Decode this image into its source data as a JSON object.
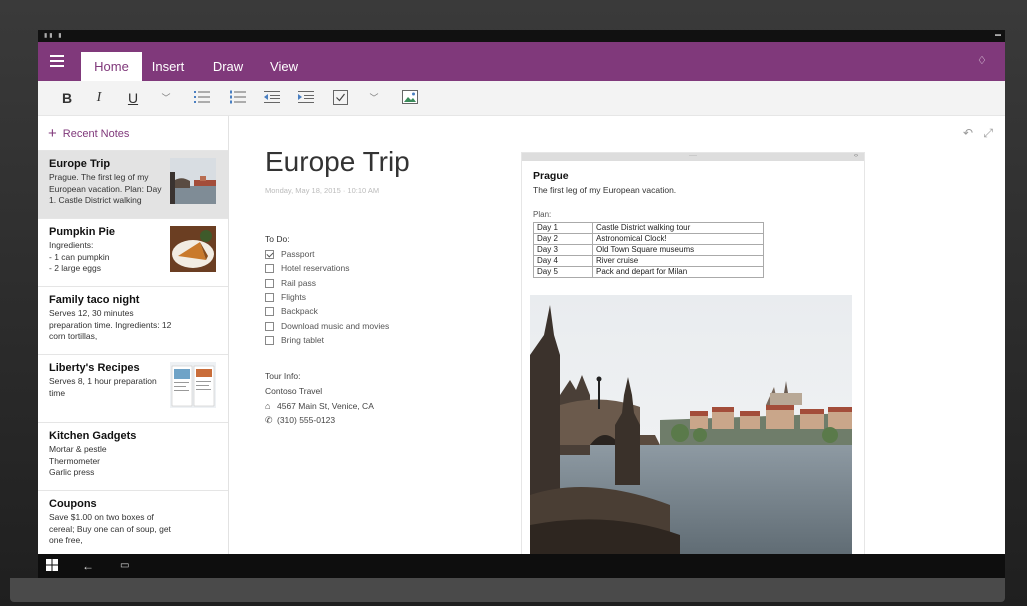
{
  "tabs": [
    "Home",
    "Insert",
    "Draw",
    "View"
  ],
  "toolbar": {
    "bold": "B",
    "italic": "I",
    "underline": "U"
  },
  "sidebar": {
    "recent_label": "Recent Notes",
    "notes": [
      {
        "title": "Europe Trip",
        "body": "Prague. The first leg of my European vacation. Plan: Day 1. Castle District walking"
      },
      {
        "title": "Pumpkin Pie",
        "body": "Ingredients:\n- 1 can pumpkin\n- 2 large eggs"
      },
      {
        "title": "Family taco night",
        "body": "Serves 12, 30 minutes preparation time. Ingredients: 12 corn tortillas,"
      },
      {
        "title": "Liberty's Recipes",
        "body": "Serves 8, 1 hour preparation time"
      },
      {
        "title": "Kitchen Gadgets",
        "body": "Mortar & pestle\nThermometer\nGarlic press"
      },
      {
        "title": "Coupons",
        "body": "Save $1.00 on two boxes of cereal; Buy one can of soup, get one free,"
      }
    ]
  },
  "page": {
    "title": "Europe Trip",
    "date": "Monday, May 18, 2015 · 10:10 AM",
    "todo_label": "To Do:",
    "todos": [
      {
        "label": "Passport",
        "checked": true
      },
      {
        "label": "Hotel reservations",
        "checked": false
      },
      {
        "label": "Rail pass",
        "checked": false
      },
      {
        "label": "Flights",
        "checked": false
      },
      {
        "label": "Backpack",
        "checked": false
      },
      {
        "label": "Download music and movies",
        "checked": false
      },
      {
        "label": "Bring tablet",
        "checked": false
      }
    ],
    "tour_label": "Tour Info:",
    "tour_company": "Contoso Travel",
    "tour_address": "4567 Main St, Venice, CA",
    "tour_phone": "(310) 555-0123",
    "container": {
      "title": "Prague",
      "subtitle": "The first leg of my European vacation.",
      "plan_label": "Plan:",
      "plan": [
        {
          "day": "Day 1",
          "activity": "Castle District walking tour"
        },
        {
          "day": "Day 2",
          "activity": "Astronomical Clock!"
        },
        {
          "day": "Day 3",
          "activity": "Old Town Square museums"
        },
        {
          "day": "Day 4",
          "activity": "River cruise"
        },
        {
          "day": "Day 5",
          "activity": "Pack and depart for Milan"
        }
      ]
    }
  },
  "colors": {
    "accent": "#80397b",
    "toolbar_bg": "#f3f3f3",
    "selected_note": "#e3e3e3"
  }
}
